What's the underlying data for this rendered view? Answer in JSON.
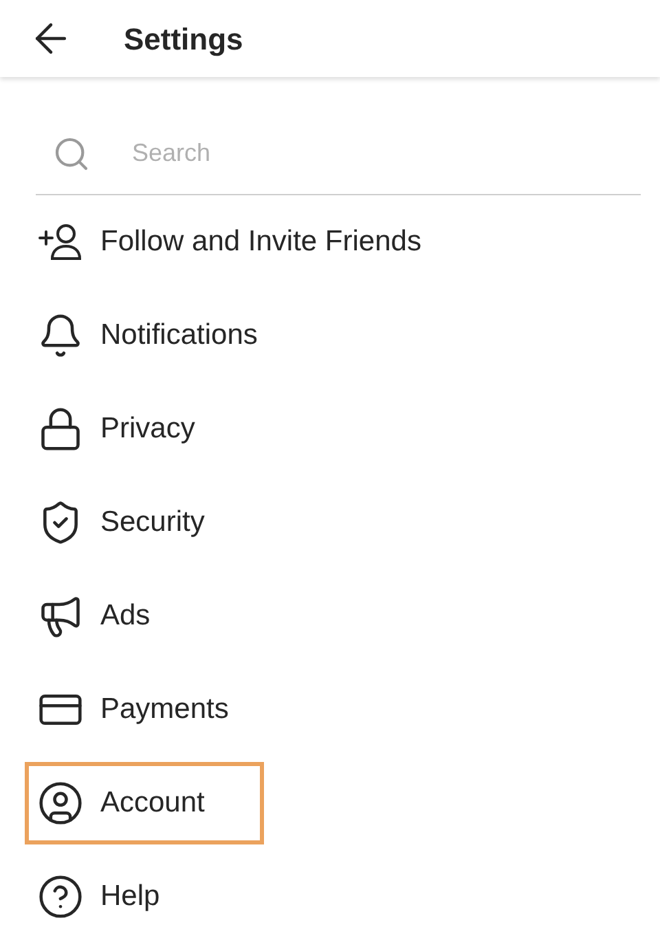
{
  "header": {
    "title": "Settings"
  },
  "search": {
    "placeholder": "Search"
  },
  "items": [
    {
      "kind": "follow",
      "label": "Follow and Invite Friends",
      "highlighted": false
    },
    {
      "kind": "notifications",
      "label": "Notifications",
      "highlighted": false
    },
    {
      "kind": "privacy",
      "label": "Privacy",
      "highlighted": false
    },
    {
      "kind": "security",
      "label": "Security",
      "highlighted": false
    },
    {
      "kind": "ads",
      "label": "Ads",
      "highlighted": false
    },
    {
      "kind": "payments",
      "label": "Payments",
      "highlighted": false
    },
    {
      "kind": "account",
      "label": "Account",
      "highlighted": true
    },
    {
      "kind": "help",
      "label": "Help",
      "highlighted": false
    }
  ]
}
